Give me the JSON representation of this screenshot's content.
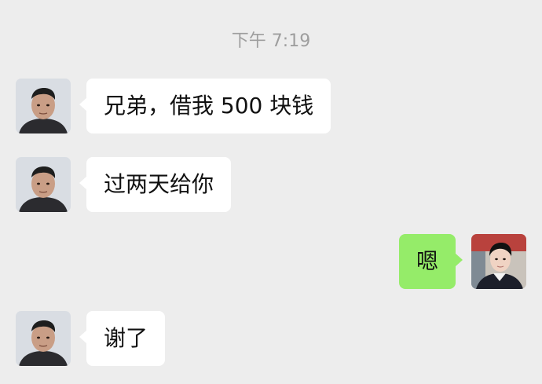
{
  "chat": {
    "timestamp": "下午 7:19",
    "messages": [
      {
        "direction": "incoming",
        "text": "兄弟，借我 500 块钱"
      },
      {
        "direction": "incoming",
        "text": "过两天给你"
      },
      {
        "direction": "outgoing",
        "text": "嗯"
      },
      {
        "direction": "incoming",
        "text": "谢了"
      }
    ]
  },
  "colors": {
    "background": "#ededed",
    "incoming_bubble": "#ffffff",
    "outgoing_bubble": "#95ec69",
    "timestamp_text": "#9e9e9e"
  },
  "icons": {
    "contact_avatar": "contact-avatar",
    "self_avatar": "self-avatar"
  }
}
